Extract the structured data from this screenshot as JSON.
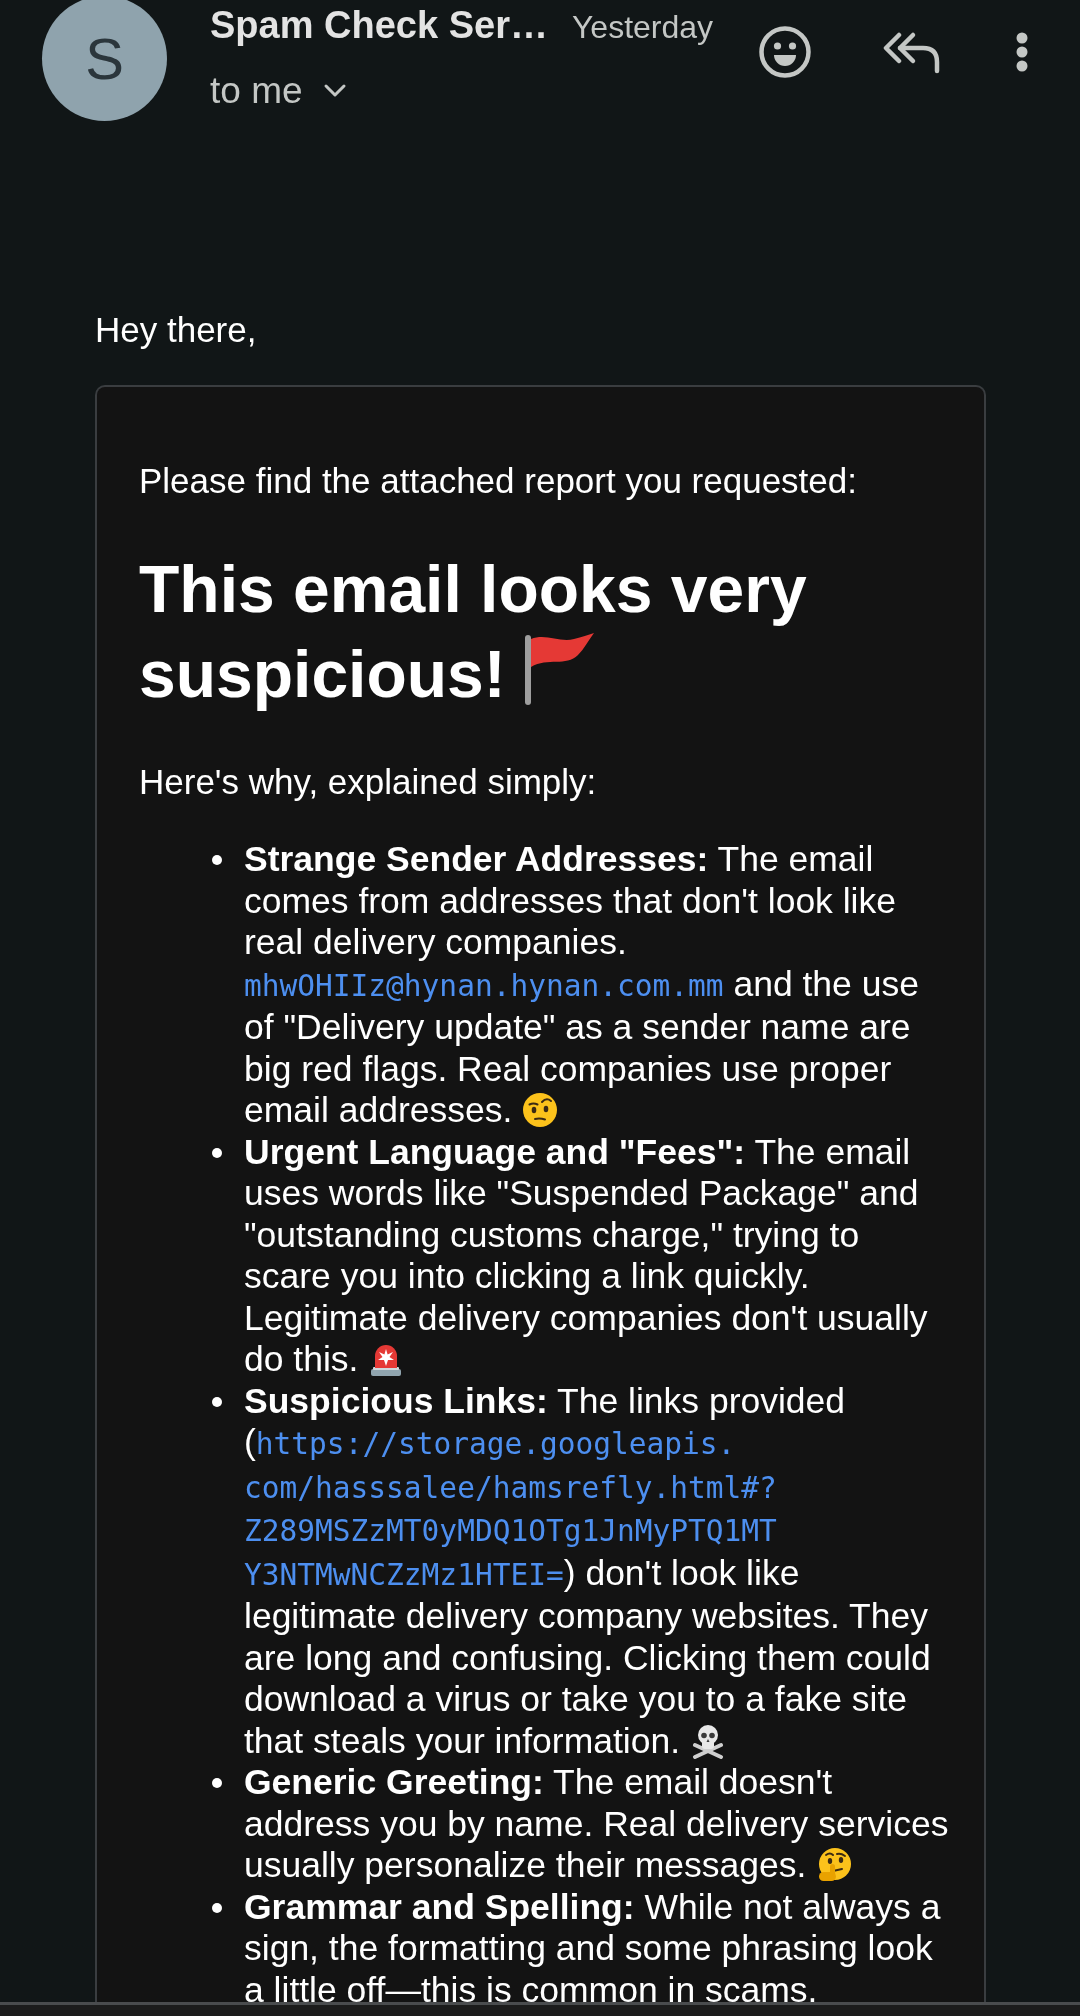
{
  "header": {
    "avatar_initial": "S",
    "sender": "Spam Check Ser…",
    "time": "Yesterday",
    "recipients": "to me"
  },
  "message": {
    "greeting": "Hey there,",
    "intro": "Please find the attached report you requested:",
    "heading": "This email looks very suspicious!",
    "lead": "Here's why, explained simply:",
    "reasons": [
      {
        "segments": [
          {
            "kind": "bold",
            "text": "Strange Sender Addresses:"
          },
          {
            "kind": "text",
            "text": " The email comes from addresses that don't look like real delivery companies. "
          },
          {
            "kind": "email",
            "text": "mhwOHIIz@hynan.hynan.com.mm"
          },
          {
            "kind": "text",
            "text": " and the use of \"Delivery update\" as a sender name are big red flags. Real companies use proper email addresses."
          }
        ]
      },
      {
        "segments": [
          {
            "kind": "bold",
            "text": "Urgent Language and \"Fees\":"
          },
          {
            "kind": "text",
            "text": " The email uses words like \"Suspended Package\" and \"outstanding customs charge,\" trying to scare you into clicking a link quickly. Legitimate delivery companies don't usually do this."
          }
        ]
      },
      {
        "segments": [
          {
            "kind": "bold",
            "text": "Suspicious Links:"
          },
          {
            "kind": "text",
            "text": " The links provided ("
          },
          {
            "kind": "url",
            "text": "https://storage.googleapis."
          },
          {
            "kind": "url",
            "text": "com/hasssalee/hamsrefly.html#?"
          },
          {
            "kind": "url",
            "text": "Z289MSZzMT0yMDQ1OTg1JnMyPTQ1MT"
          },
          {
            "kind": "url",
            "text": "Y3NTMwNCZzMz1HTEI="
          },
          {
            "kind": "text",
            "text": ") don't look like legitimate delivery company websites. They are long and confusing. Clicking them could download a virus or take you to a fake site that steals your information."
          }
        ]
      },
      {
        "segments": [
          {
            "kind": "bold",
            "text": "Generic Greeting:"
          },
          {
            "kind": "text",
            "text": " The email doesn't address you by name. Real delivery services usually personalize their messages."
          }
        ]
      },
      {
        "segments": [
          {
            "kind": "bold",
            "text": "Grammar and Spelling:"
          },
          {
            "kind": "text",
            "text": " While not always a sign, the formatting and some phrasing look a little off—this is common in scams."
          }
        ]
      }
    ]
  }
}
